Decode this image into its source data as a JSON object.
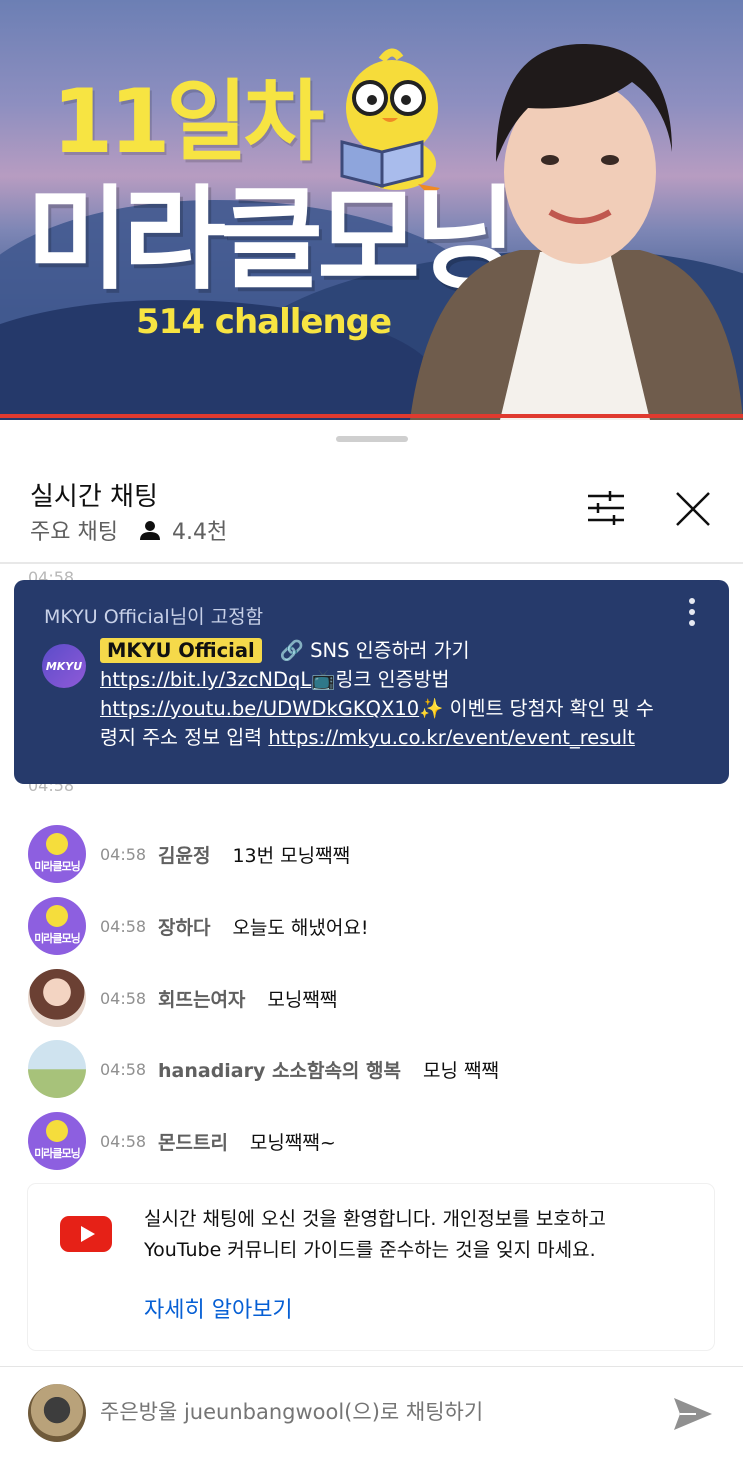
{
  "video": {
    "title_day": "11일차",
    "title_main": "미라클모닝",
    "subtitle": "514 challenge"
  },
  "chat": {
    "title": "실시간 채팅",
    "mode": "주요 채팅",
    "viewer_count": "4.4천",
    "icons": {
      "filter": "sliders-icon",
      "close": "close-icon",
      "viewers": "person-icon",
      "send": "send-icon",
      "more": "more-vertical-icon"
    }
  },
  "pinned": {
    "header": "MKYU Official님이 고정함",
    "author": "MKYU Official",
    "avatar_text": "MKYU",
    "segments": {
      "s1": "🔗 SNS 인증하러 가기 ",
      "link1": "https://bit.ly/3zcNDqL",
      "s2": "📺링크 인증방법 ",
      "link2": "https://youtu.be/UDWDkGKQX10",
      "s3": "✨ 이벤트 당첨자 확인 및 수령지 주소 정보 입력 ",
      "link3": "https://mkyu.co.kr/event/event_result"
    }
  },
  "ghost_rows": [
    "04:58",
    "04:58"
  ],
  "messages": [
    {
      "time": "04:58",
      "name": "김윤정",
      "text": "13번 모닝짹짹",
      "avatar": "duck",
      "avatar_label": "미라클모닝"
    },
    {
      "time": "04:58",
      "name": "장하다",
      "text": "오늘도 해냈어요!",
      "avatar": "duck",
      "avatar_label": "미라클모닝"
    },
    {
      "time": "04:58",
      "name": "회뜨는여자",
      "text": "모닝짹짹",
      "avatar": "woman"
    },
    {
      "time": "04:58",
      "name": "hanadiary 소소함속의 행복",
      "text": "모닝 짹짹",
      "avatar": "field"
    },
    {
      "time": "04:58",
      "name": "몬드트리",
      "text": "모닝짹짹~",
      "avatar": "duck",
      "avatar_label": "미라클모닝"
    }
  ],
  "welcome": {
    "text": "실시간 채팅에 오신 것을 환영합니다. 개인정보를 보호하고 YouTube 커뮤니티 가이드를 준수하는 것을 잊지 마세요.",
    "link": "자세히 알아보기"
  },
  "input": {
    "placeholder": "주은방울 jueunbangwool(으)로 채팅하기"
  }
}
